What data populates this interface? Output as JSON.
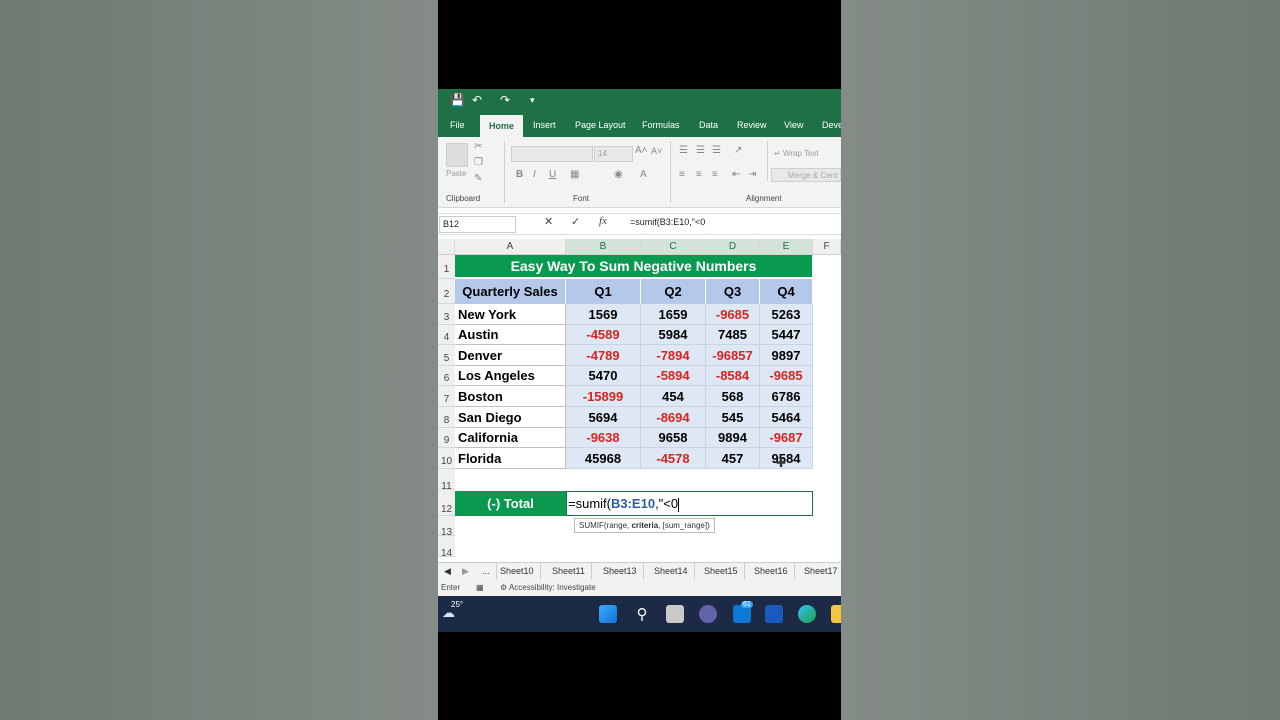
{
  "ribbon": {
    "tabs": [
      "File",
      "Home",
      "Insert",
      "Page Layout",
      "Formulas",
      "Data",
      "Review",
      "View",
      "Deve"
    ],
    "active_tab": "Home",
    "groups": {
      "clipboard": "Clipboard",
      "font": "Font",
      "alignment": "Alignment"
    },
    "paste": "Paste",
    "font_size": "14",
    "wrap_text": "Wrap Text",
    "merge": "Merge & Cent"
  },
  "formula_bar": {
    "name_box": "B12",
    "formula": "=sumif(B3:E10,\"<0"
  },
  "sheet": {
    "columns": [
      "A",
      "B",
      "C",
      "D",
      "E",
      "F"
    ],
    "rows": [
      "1",
      "2",
      "3",
      "4",
      "5",
      "6",
      "7",
      "8",
      "9",
      "10",
      "11",
      "12",
      "13",
      "14"
    ],
    "title": "Easy Way To Sum Negative Numbers",
    "header": [
      "Quarterly Sales",
      "Q1",
      "Q2",
      "Q3",
      "Q4"
    ],
    "data": [
      {
        "city": "New York",
        "values": [
          "1569",
          "1659",
          "-9685",
          "5263"
        ]
      },
      {
        "city": "Austin",
        "values": [
          "-4589",
          "5984",
          "7485",
          "5447"
        ]
      },
      {
        "city": "Denver",
        "values": [
          "-4789",
          "-7894",
          "-96857",
          "9897"
        ]
      },
      {
        "city": "Los Angeles",
        "values": [
          "5470",
          "-5894",
          "-8584",
          "-9685"
        ]
      },
      {
        "city": "Boston",
        "values": [
          "-15899",
          "454",
          "568",
          "6786"
        ]
      },
      {
        "city": "San Diego",
        "values": [
          "5694",
          "-8694",
          "545",
          "5464"
        ]
      },
      {
        "city": "California",
        "values": [
          "-9638",
          "9658",
          "9894",
          "-9687"
        ]
      },
      {
        "city": "Florida",
        "values": [
          "45968",
          "-4578",
          "457",
          "9584"
        ]
      }
    ],
    "total_label": "(-) Total",
    "edit_prefix": "=sumif(",
    "edit_range": "B3:E10",
    "edit_suffix": ",\"<0",
    "tooltip": {
      "pre": "SUMIF(range, ",
      "bold": "criteria",
      "post": ", [sum_range])"
    }
  },
  "sheet_tabs": [
    "...",
    "Sheet10",
    "Sheet11",
    "Sheet13",
    "Sheet14",
    "Sheet15",
    "Sheet16",
    "Sheet17"
  ],
  "status_bar": {
    "mode": "Enter",
    "accessibility": "Accessibility: Investigate"
  },
  "taskbar": {
    "weather": "25°",
    "badge": "61"
  },
  "colors": {
    "excel_green": "#1e7145",
    "title_green": "#0a9a4f",
    "negative_red": "#d9231f",
    "header_blue": "#b4c9ea"
  }
}
